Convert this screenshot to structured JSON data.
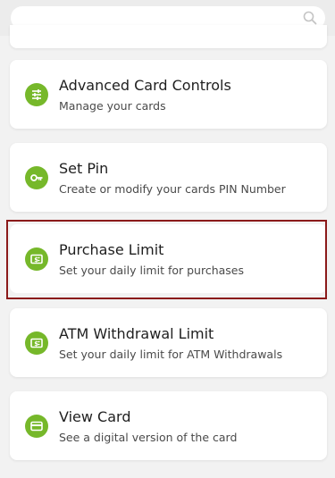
{
  "search": {
    "placeholder": ""
  },
  "menu": {
    "items": [
      {
        "title": "Advanced Card Controls",
        "subtitle": "Manage your cards",
        "icon": "sliders-icon"
      },
      {
        "title": "Set Pin",
        "subtitle": "Create or modify your cards PIN Number",
        "icon": "key-icon"
      },
      {
        "title": "Purchase Limit",
        "subtitle": "Set your daily limit for purchases",
        "icon": "cash-icon",
        "selected": true
      },
      {
        "title": "ATM Withdrawal Limit",
        "subtitle": "Set your daily limit for ATM Withdrawals",
        "icon": "cash-icon"
      },
      {
        "title": "View Card",
        "subtitle": "See a digital version of the card",
        "icon": "credit-card-icon"
      }
    ]
  },
  "colors": {
    "accent": "#76b82a",
    "selection": "#8b1a1a",
    "background": "#f2f2f2"
  }
}
